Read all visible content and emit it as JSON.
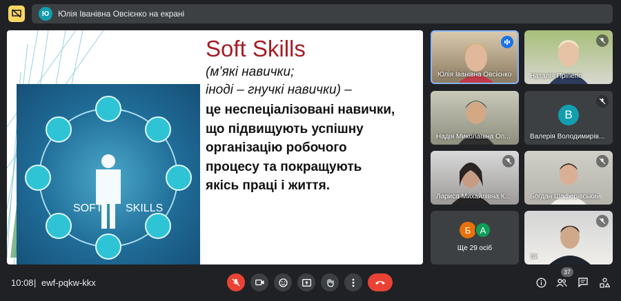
{
  "topbar": {
    "presenter_initial": "Ю",
    "presenting_text": "Юлія Іванівна Овсієнко на екрані"
  },
  "slide": {
    "title": "Soft Skills",
    "subtitle_line1": "(м’які навички;",
    "subtitle_line2": "іноді – гнучкі навички) –",
    "body_lines": [
      "це неспеціалізовані навички,",
      "що підвищують успішну",
      "організацію робочого",
      "процесу та покращують",
      "якісь праці і життя."
    ],
    "image": {
      "left_label": "SOFT",
      "right_label": "SKILLS"
    }
  },
  "participants": [
    {
      "name": "Юлія Іванівна Овсієнко",
      "speaking": true
    },
    {
      "name": "Наталія Пріпепо",
      "muted": true
    },
    {
      "name": "Надія Миколаївна Оп...",
      "muted": false
    },
    {
      "name": "Валерія Володимирів...",
      "muted": true,
      "initial": "В"
    },
    {
      "name": "Лариса Михайлівна К...",
      "muted": true
    },
    {
      "name": "Богдан Шаферівський",
      "muted": true
    },
    {
      "name": "Ще 29 осіб",
      "initials": [
        "Б",
        "А"
      ]
    },
    {
      "name": "Ви",
      "muted": true
    }
  ],
  "bottombar": {
    "time": "10:08",
    "separator": "|",
    "meeting_code": "ewf-pqkw-kkx",
    "participants_count": "37"
  },
  "colors": {
    "background": "#202124",
    "title_red": "#a61c25",
    "hangup_red": "#ea4335",
    "speaking_blue": "#1a73e8",
    "avatar_b_orange": "#e8710a",
    "avatar_a_green": "#0f9d58",
    "avatar_v_teal": "#129eaf"
  }
}
